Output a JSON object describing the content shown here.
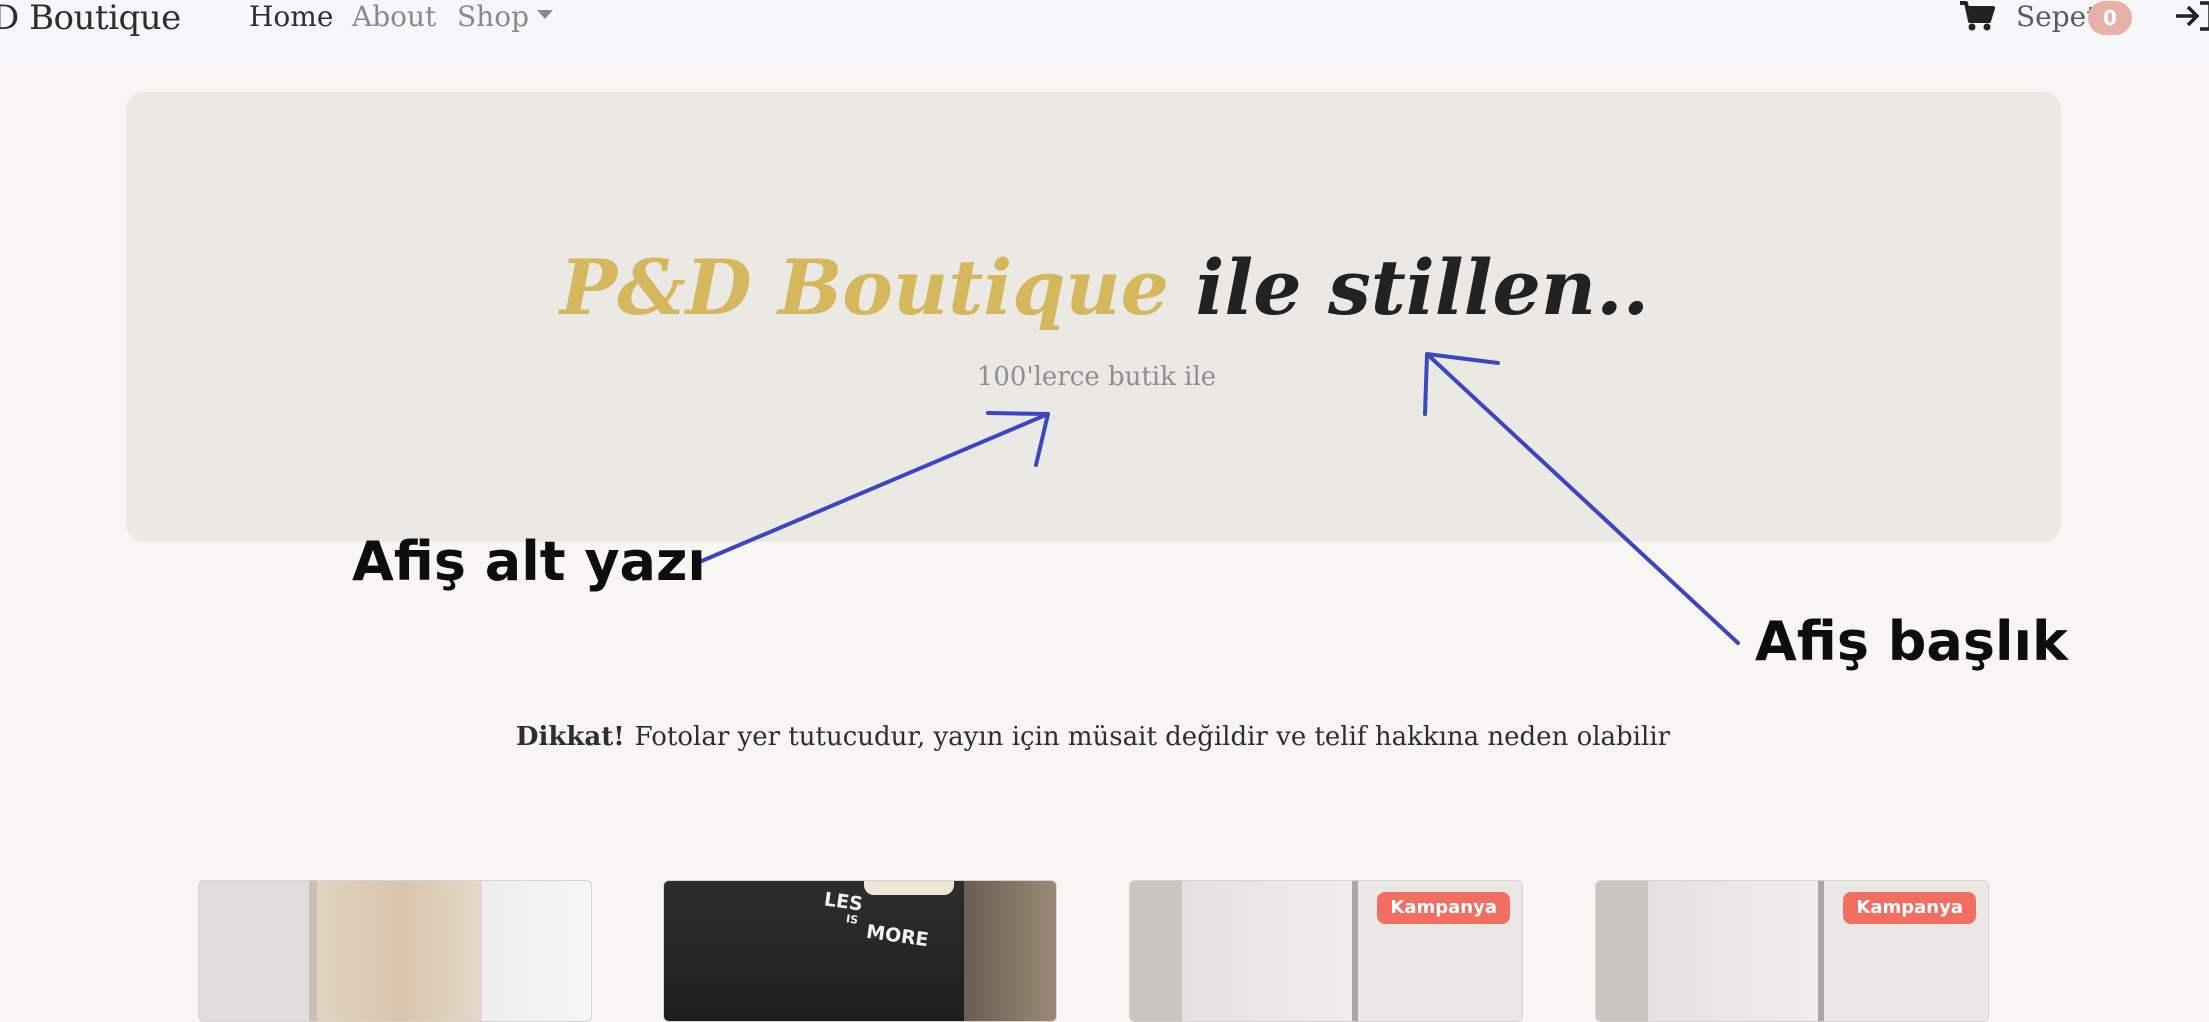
{
  "navbar": {
    "brand": "D Boutique",
    "links": [
      "Home",
      "About",
      "Shop"
    ],
    "cart_label": "Sepet",
    "cart_count": "0"
  },
  "hero": {
    "title_brand": "P&D Boutique",
    "title_rest": "ile stillen..",
    "subtitle": "100'lerce butik ile"
  },
  "annotations": {
    "subtitle_label": "Afiş alt yazı",
    "title_label": "Afiş başlık",
    "arrow_color": "#3a46c2"
  },
  "notice": {
    "strong": "Dikkat!",
    "text": "Fotolar yer tutucudur, yayın için müsait değildir ve telif hakkına neden olabilir"
  },
  "products": [
    {
      "badge": ""
    },
    {
      "badge": "",
      "shirt_text_1": "LES",
      "shirt_text_2": "IS",
      "shirt_text_3": "MORE"
    },
    {
      "badge": "Kampanya"
    },
    {
      "badge": "Kampanya"
    }
  ],
  "colors": {
    "accent_gold": "#d5b85e",
    "badge_red": "#f16e60",
    "cart_badge": "#e7b1aa",
    "hero_bg": "#ebe9e4"
  }
}
